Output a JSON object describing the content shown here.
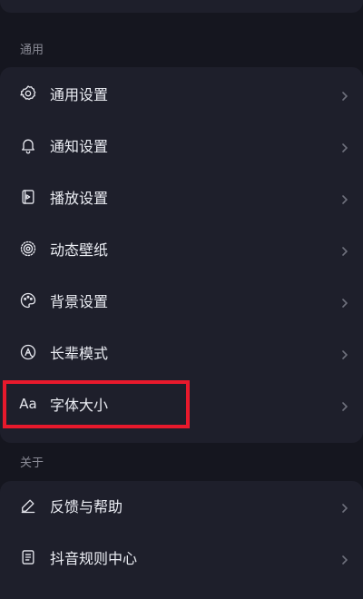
{
  "sections": {
    "general": {
      "title": "通用",
      "items": [
        {
          "label": "通用设置",
          "icon": "gear-icon"
        },
        {
          "label": "通知设置",
          "icon": "bell-icon"
        },
        {
          "label": "播放设置",
          "icon": "playback-icon"
        },
        {
          "label": "动态壁纸",
          "icon": "live-wallpaper-icon"
        },
        {
          "label": "背景设置",
          "icon": "palette-icon"
        },
        {
          "label": "长辈模式",
          "icon": "elder-mode-icon"
        },
        {
          "label": "字体大小",
          "icon": "font-size-icon",
          "icon_text": "Aa"
        }
      ]
    },
    "about": {
      "title": "关于",
      "items": [
        {
          "label": "反馈与帮助",
          "icon": "edit-pen-icon"
        },
        {
          "label": "抖音规则中心",
          "icon": "document-list-icon"
        }
      ]
    }
  },
  "highlight": {
    "target": "字体大小",
    "color": "#e8192c"
  },
  "colors": {
    "background": "#15161f",
    "card": "#1e1f2b",
    "text": "#eceef4",
    "section_title": "#8a8b96",
    "chevron": "#6e707c"
  }
}
